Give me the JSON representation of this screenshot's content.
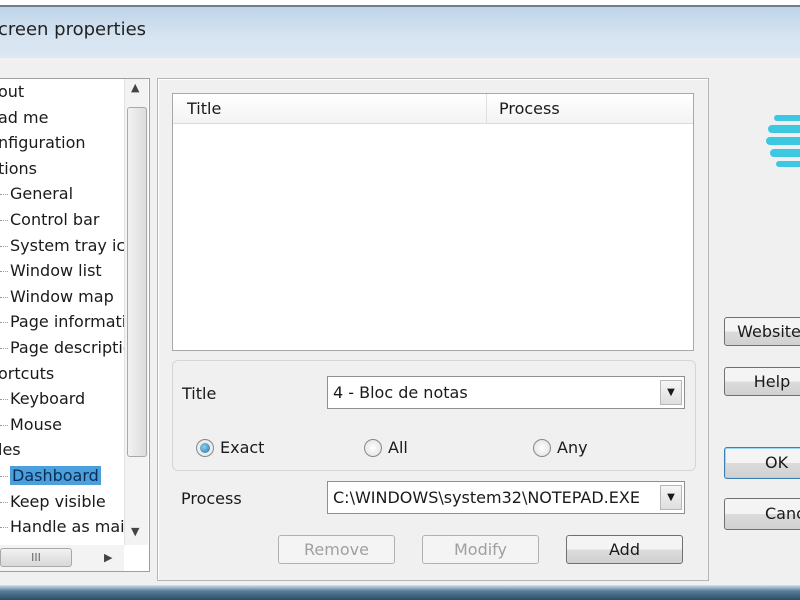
{
  "window": {
    "title": "creen properties"
  },
  "tree": {
    "items": [
      {
        "label": "out",
        "child": false
      },
      {
        "label": "ad me",
        "child": false
      },
      {
        "label": "nfiguration",
        "child": false
      },
      {
        "label": "tions",
        "child": false
      },
      {
        "label": "General",
        "child": true
      },
      {
        "label": "Control bar",
        "child": true
      },
      {
        "label": "System tray ico",
        "child": true
      },
      {
        "label": "Window list",
        "child": true
      },
      {
        "label": "Window map",
        "child": true
      },
      {
        "label": "Page informati",
        "child": true
      },
      {
        "label": "Page descriptic",
        "child": true
      },
      {
        "label": "ortcuts",
        "child": false
      },
      {
        "label": "Keyboard",
        "child": true
      },
      {
        "label": "Mouse",
        "child": true
      },
      {
        "label": "les",
        "child": false
      },
      {
        "label": "Dashboard",
        "child": true,
        "selected": true
      },
      {
        "label": "Keep visible",
        "child": true
      },
      {
        "label": "Handle as mair",
        "child": true
      }
    ],
    "hscroll_grip": "III"
  },
  "list": {
    "columns": [
      "Title",
      "Process"
    ]
  },
  "form": {
    "title_label": "Title",
    "title_value": "4 - Bloc de notas",
    "match_options": [
      "Exact",
      "All",
      "Any"
    ],
    "match_selected": "Exact",
    "process_label": "Process",
    "process_value": "C:\\WINDOWS\\system32\\NOTEPAD.EXE"
  },
  "actions": {
    "remove": "Remove",
    "modify": "Modify",
    "add": "Add"
  },
  "side": {
    "website": "Website",
    "help": "Help",
    "ok": "OK",
    "cancel": "Cancel"
  },
  "colors": {
    "accent": "#4a9fdc",
    "logo": "#3cc8e0"
  }
}
